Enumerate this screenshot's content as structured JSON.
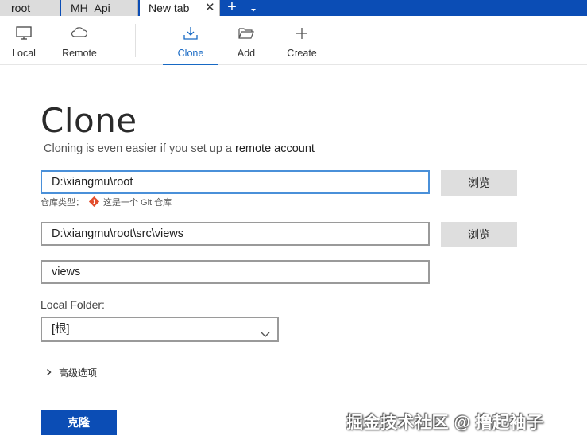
{
  "tabs": [
    {
      "label": "root"
    },
    {
      "label": "MH_Api"
    },
    {
      "label": "New tab",
      "close": "✕"
    }
  ],
  "tab_add": "+",
  "toolbar": {
    "local": "Local",
    "remote": "Remote",
    "clone": "Clone",
    "add": "Add",
    "create": "Create"
  },
  "main": {
    "title": "Clone",
    "subtitle_prefix": "Cloning is even easier if you set up a ",
    "subtitle_link": "remote account",
    "source_path": "D:\\xiangmu\\root",
    "browse_label": "浏览",
    "repo_type_label": "仓库类型：",
    "repo_type_value": "这是一个 Git 仓库",
    "destination_path": "D:\\xiangmu\\root\\src\\views",
    "name_value": "views",
    "local_folder_label": "Local Folder:",
    "local_folder_value": "[根]",
    "advanced_label": "高级选项",
    "clone_button": "克隆"
  },
  "watermark": "掘金技术社区 @ 撸起袖子",
  "colors": {
    "accent": "#0b4db5",
    "active_tab_text": "#1769c4",
    "git_logo": "#e24e2d"
  },
  "icons": {
    "local": "monitor-icon",
    "remote": "cloud-icon",
    "clone": "download-icon",
    "add": "folder-open-icon",
    "create": "plus-icon",
    "tab_dropdown": "chevron-down-icon",
    "select": "chevron-down-icon",
    "advanced": "chevron-right-icon",
    "repo_type": "git-logo-icon"
  }
}
